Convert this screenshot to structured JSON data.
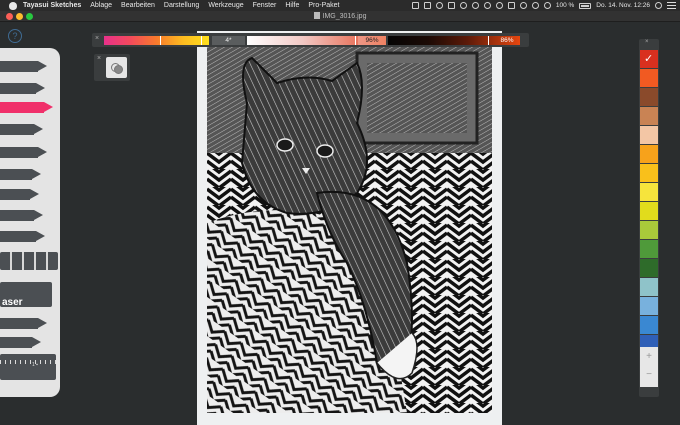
{
  "menubar": {
    "app_name": "Tayasui Sketches",
    "items": [
      "Ablage",
      "Bearbeiten",
      "Darstellung",
      "Werkzeuge",
      "Fenster",
      "Hilfe",
      "Pro-Paket"
    ],
    "battery": "100 %",
    "clock": "Do. 14. Nov.  12:26"
  },
  "window": {
    "title": "IMG_3016.jpg"
  },
  "help": {
    "label": "?"
  },
  "toolbar": {
    "close_label": "×",
    "size": "4*",
    "opacity": "96%",
    "intensity": "86%",
    "colors": {
      "gradient_start": "#e8318a",
      "gradient_end": "#ffe01c"
    }
  },
  "layers": {
    "close_label": "×"
  },
  "tools": {
    "eraser_label": "aser",
    "ruler_label": "1 ▪",
    "selected_tool_color": "#f0306a"
  },
  "palette": {
    "close_label": "×",
    "colors": [
      "#d9301f",
      "#f15a22",
      "#8a4a2b",
      "#c98354",
      "#f3c6a5",
      "#f7a21b",
      "#f9c01b",
      "#f6e43c",
      "#e1dc1c",
      "#a9c93a",
      "#4f9a3a",
      "#2e6b2a",
      "#8fc3c9",
      "#78b1dd",
      "#3a88d2",
      "#2f5fb7"
    ],
    "selected_index": 0,
    "add_label": "+",
    "remove_label": "−"
  }
}
